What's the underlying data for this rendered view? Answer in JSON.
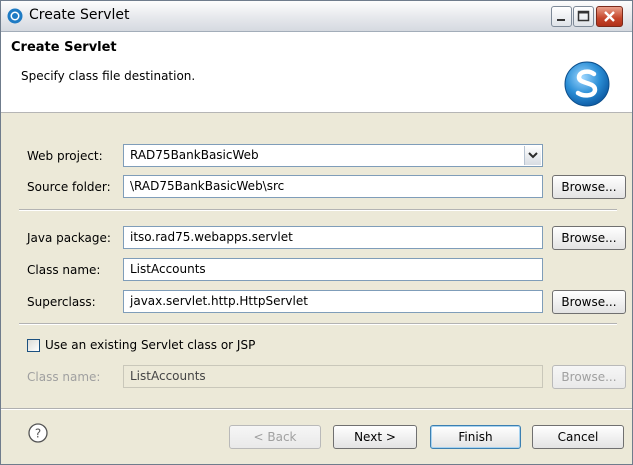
{
  "window": {
    "title": "Create Servlet"
  },
  "banner": {
    "title": "Create Servlet",
    "subtitle": "Specify class file destination."
  },
  "form": {
    "web_project_label": "Web project:",
    "web_project_value": "RAD75BankBasicWeb",
    "source_folder_label": "Source folder:",
    "source_folder_value": "\\RAD75BankBasicWeb\\src",
    "java_package_label": "Java package:",
    "java_package_value": "itso.rad75.webapps.servlet",
    "class_name_label": "Class name:",
    "class_name_value": "ListAccounts",
    "superclass_label": "Superclass:",
    "superclass_value": "javax.servlet.http.HttpServlet",
    "use_existing_label": "Use an existing Servlet class or JSP",
    "use_existing_checked": false,
    "existing_class_label": "Class name:",
    "existing_class_value": "ListAccounts",
    "browse_label": "Browse..."
  },
  "footer": {
    "back_label": "< Back",
    "next_label": "Next >",
    "finish_label": "Finish",
    "cancel_label": "Cancel"
  },
  "icons": {
    "app": "eclipse-icon",
    "banner": "servlet-wizard-icon",
    "help": "help-icon"
  },
  "colors": {
    "window_bg": "#ece9d8",
    "banner_bg": "#ffffff",
    "logo_blue": "#2a8ed6",
    "close_red": "#c5452a"
  }
}
